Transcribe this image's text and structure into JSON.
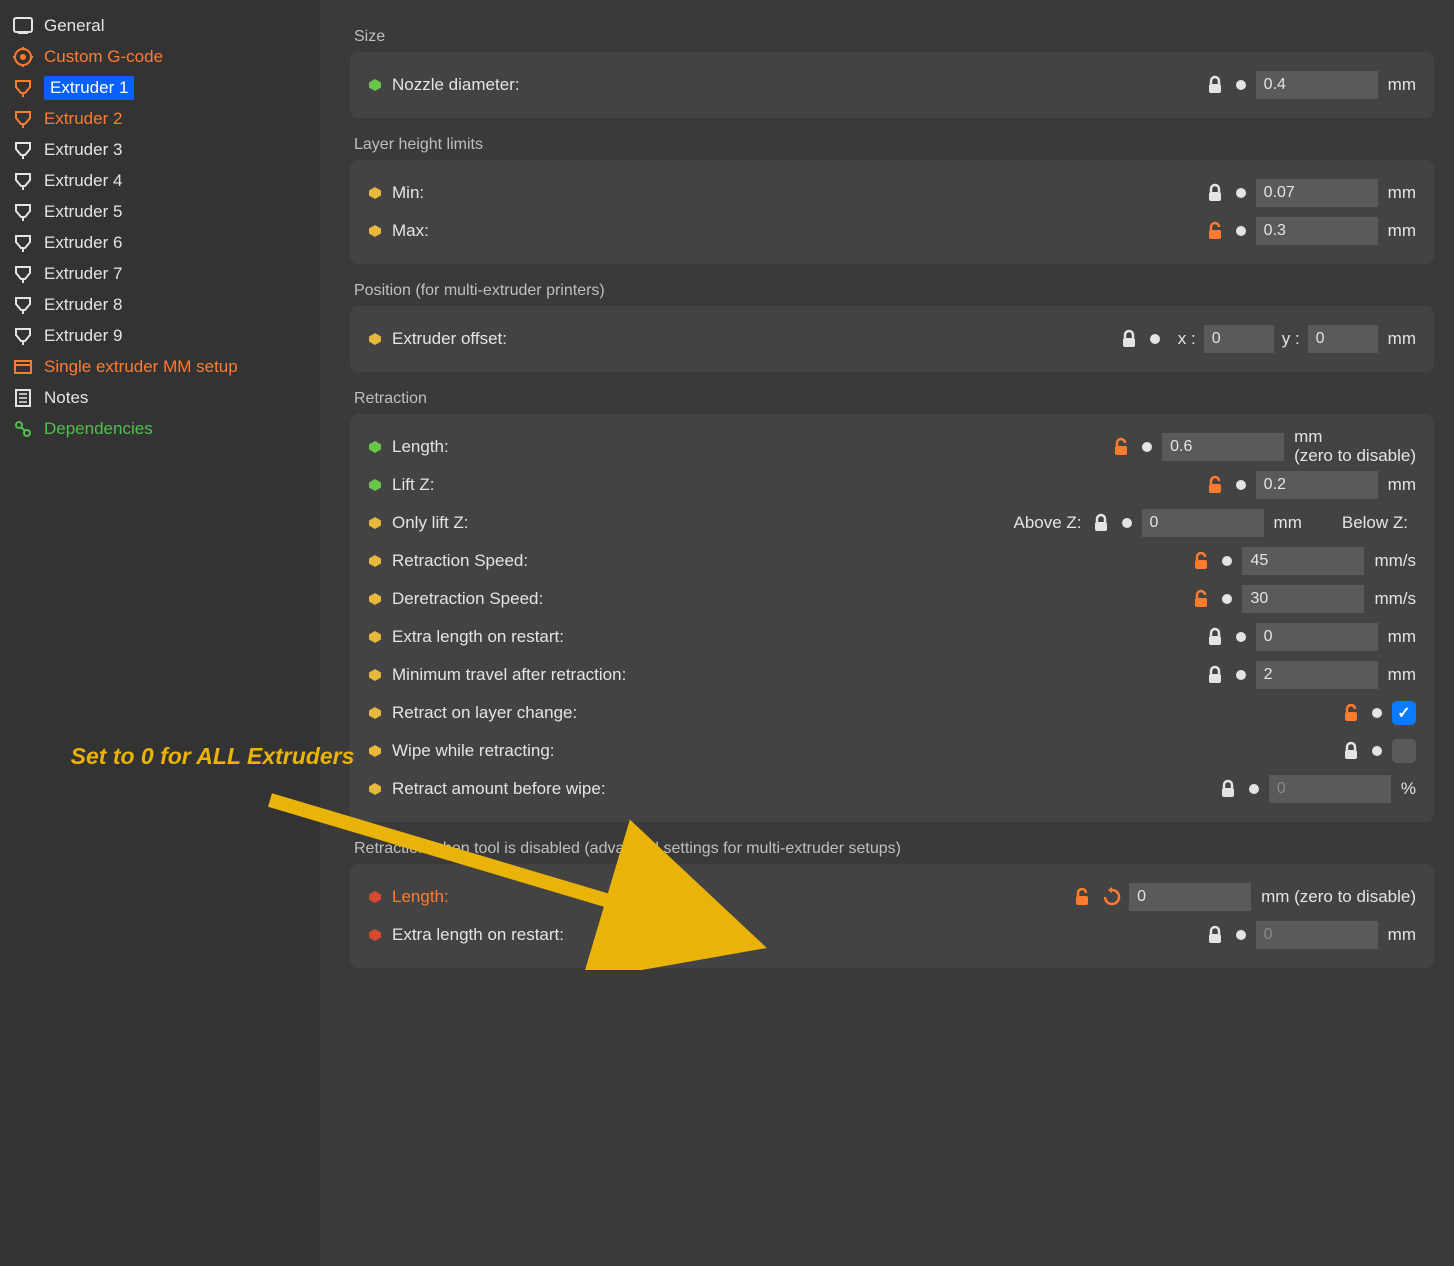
{
  "sidebar": {
    "items": [
      {
        "label": "General",
        "icon": "general",
        "color": "default"
      },
      {
        "label": "Custom G-code",
        "icon": "gcode",
        "color": "orange"
      },
      {
        "label": "Extruder 1",
        "icon": "extruder",
        "color": "orange",
        "selected": true
      },
      {
        "label": "Extruder 2",
        "icon": "extruder",
        "color": "orange"
      },
      {
        "label": "Extruder 3",
        "icon": "extruder",
        "color": "default"
      },
      {
        "label": "Extruder 4",
        "icon": "extruder",
        "color": "default"
      },
      {
        "label": "Extruder 5",
        "icon": "extruder",
        "color": "default"
      },
      {
        "label": "Extruder 6",
        "icon": "extruder",
        "color": "default"
      },
      {
        "label": "Extruder 7",
        "icon": "extruder",
        "color": "default"
      },
      {
        "label": "Extruder 8",
        "icon": "extruder",
        "color": "default"
      },
      {
        "label": "Extruder 9",
        "icon": "extruder",
        "color": "default"
      },
      {
        "label": "Single extruder MM setup",
        "icon": "mm",
        "color": "orange"
      },
      {
        "label": "Notes",
        "icon": "notes",
        "color": "default"
      },
      {
        "label": "Dependencies",
        "icon": "deps",
        "color": "green"
      }
    ]
  },
  "sections": {
    "size": {
      "title": "Size",
      "nozzle_label": "Nozzle diameter:",
      "nozzle_value": "0.4",
      "nozzle_unit": "mm",
      "nozzle_bullet": "green",
      "nozzle_lock": "white"
    },
    "layer": {
      "title": "Layer height limits",
      "min_label": "Min:",
      "min_value": "0.07",
      "min_unit": "mm",
      "min_bullet": "yellow",
      "min_lock": "white",
      "max_label": "Max:",
      "max_value": "0.3",
      "max_unit": "mm",
      "max_bullet": "yellow",
      "max_lock": "orange"
    },
    "position": {
      "title": "Position (for multi-extruder printers)",
      "offset_label": "Extruder offset:",
      "offset_bullet": "yellow",
      "offset_lock": "white",
      "x_label": "x :",
      "x_value": "0",
      "y_label": "y :",
      "y_value": "0",
      "unit": "mm"
    },
    "retraction": {
      "title": "Retraction",
      "length_label": "Length:",
      "length_value": "0.6",
      "length_unit": "mm\n(zero to disable)",
      "length_bullet": "green",
      "length_lock": "orange",
      "liftz_label": "Lift Z:",
      "liftz_value": "0.2",
      "liftz_unit": "mm",
      "liftz_bullet": "green",
      "liftz_lock": "orange",
      "onlylift_label": "Only lift Z:",
      "onlylift_bullet": "yellow",
      "abovez_label": "Above Z:",
      "abovez_lock": "white",
      "abovez_value": "0",
      "abovez_unit": "mm",
      "belowz_label": "Below Z:",
      "rspeed_label": "Retraction Speed:",
      "rspeed_value": "45",
      "rspeed_unit": "mm/s",
      "rspeed_bullet": "yellow",
      "rspeed_lock": "orange",
      "dspeed_label": "Deretraction Speed:",
      "dspeed_value": "30",
      "dspeed_unit": "mm/s",
      "dspeed_bullet": "yellow",
      "dspeed_lock": "orange",
      "extra_label": "Extra length on restart:",
      "extra_value": "0",
      "extra_unit": "mm",
      "extra_bullet": "yellow",
      "extra_lock": "white",
      "mintravel_label": "Minimum travel after retraction:",
      "mintravel_value": "2",
      "mintravel_unit": "mm",
      "mintravel_bullet": "yellow",
      "mintravel_lock": "white",
      "rlayer_label": "Retract on layer change:",
      "rlayer_bullet": "yellow",
      "rlayer_lock": "orange",
      "rlayer_checked": true,
      "wipe_label": "Wipe while retracting:",
      "wipe_bullet": "yellow",
      "wipe_lock": "white",
      "wipe_checked": false,
      "ramount_label": "Retract amount before wipe:",
      "ramount_value": "0",
      "ramount_unit": "%",
      "ramount_bullet": "yellow",
      "ramount_lock": "white"
    },
    "retraction_disabled": {
      "title": "Retraction when tool is disabled (advanced settings for multi-extruder setups)",
      "length_label": "Length:",
      "length_value": "0",
      "length_unit": "mm (zero to disable)",
      "length_bullet": "red",
      "length_lock": "orange",
      "length_label_color": "orange",
      "extra_label": "Extra length on restart:",
      "extra_value": "0",
      "extra_unit": "mm",
      "extra_bullet": "red",
      "extra_lock": "white"
    }
  },
  "annotation": {
    "text": "Set to 0 for ALL Extruders"
  },
  "colors": {
    "green": "#6ac64a",
    "yellow": "#e8b83b",
    "red": "#d84a2f",
    "orange": "#ff7b2e",
    "white": "#e4e4e4"
  }
}
